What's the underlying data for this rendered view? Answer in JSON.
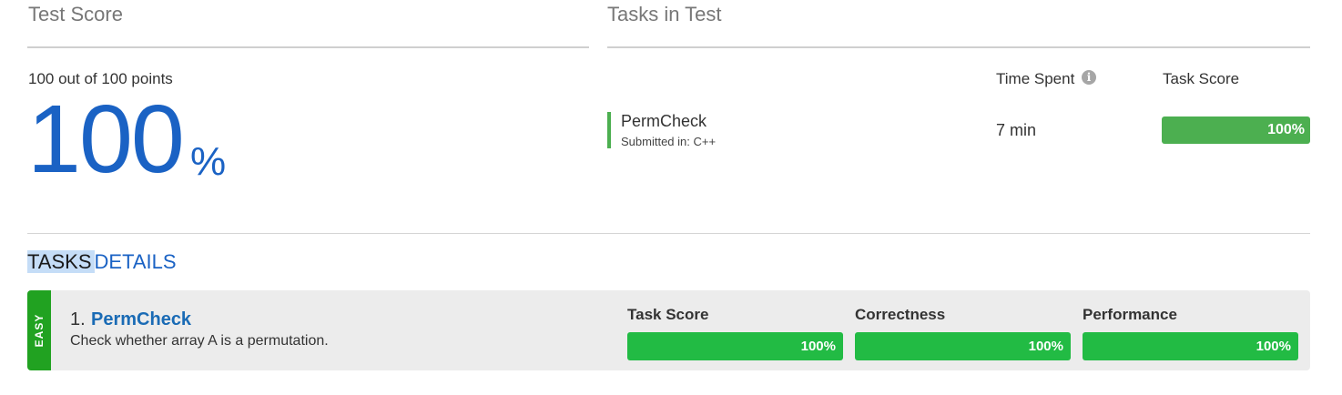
{
  "test_score": {
    "title": "Test Score",
    "points_label": "100 out of 100 points",
    "percent_value": "100",
    "percent_sign": "%"
  },
  "tasks_in_test": {
    "title": "Tasks in Test",
    "time_spent_header": "Time Spent",
    "info_icon": "info-icon",
    "task_score_header": "Task Score",
    "task": {
      "name": "PermCheck",
      "submitted": "Submitted in: C++",
      "time": "7 min",
      "score_label": "100%",
      "score_fraction": 1.0
    }
  },
  "tasks_details": {
    "title_highlight": "TASKS",
    "title_rest": "DETAILS",
    "task": {
      "difficulty": "EASY",
      "number": "1.",
      "name": "PermCheck",
      "description": "Check whether array A is a permutation.",
      "metrics": [
        {
          "label": "Task Score",
          "value": "100%",
          "fraction": 1.0
        },
        {
          "label": "Correctness",
          "value": "100%",
          "fraction": 1.0
        },
        {
          "label": "Performance",
          "value": "100%",
          "fraction": 1.0
        }
      ]
    }
  },
  "colors": {
    "accent_blue": "#1a62c4",
    "success_green": "#4caf50",
    "metric_green": "#22bb44",
    "easy_green": "#21a221"
  }
}
